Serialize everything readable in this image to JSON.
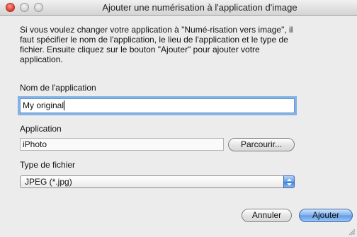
{
  "window": {
    "title": "Ajouter une numérisation à l'application d'image"
  },
  "description": "Si vous voulez changer votre application à \"Numé-risation vers image\", il\nfaut spécifier le nom de l'application, le lieu de l'application et le type de\nfichier. Ensuite cliquez sur le bouton \"Ajouter\" pour ajouter votre\napplication.",
  "app_name": {
    "label": "Nom de l'application",
    "value": "My original"
  },
  "application": {
    "label": "Application",
    "value": "iPhoto",
    "browse_label": "Parcourir..."
  },
  "file_type": {
    "label": "Type de fichier",
    "selected": "JPEG (*.jpg)"
  },
  "buttons": {
    "cancel": "Annuler",
    "add": "Ajouter"
  },
  "colors": {
    "focus_ring": "#82b2e8",
    "default_button": "#5f9be6",
    "window_bg": "#ececec"
  }
}
